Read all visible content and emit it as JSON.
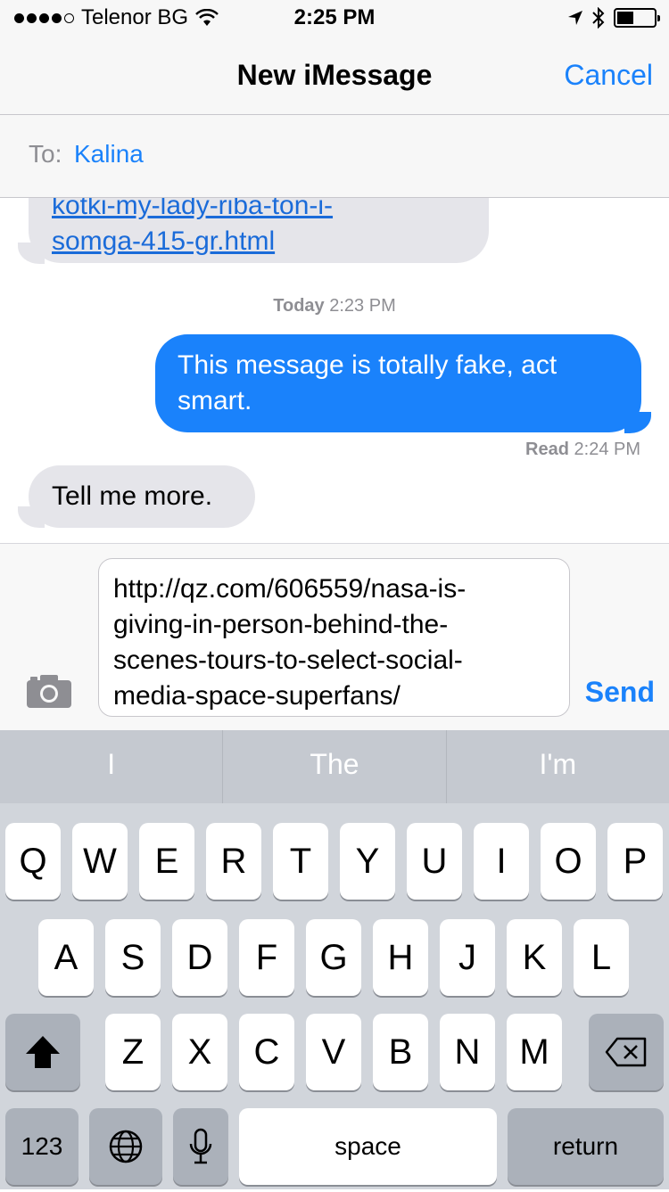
{
  "status_bar": {
    "carrier": "Telenor BG",
    "time": "2:25 PM"
  },
  "nav": {
    "title": "New iMessage",
    "cancel": "Cancel"
  },
  "to_field": {
    "label": "To:",
    "recipient": "Kalina"
  },
  "conversation": {
    "partial_link_line1": "kotki-my-lady-riba-ton-i-",
    "partial_link_line2": "somga-415-gr.html",
    "timestamp_day": "Today",
    "timestamp_time": "2:23 PM",
    "outgoing_line1": "This message is totally fake, act",
    "outgoing_line2": "smart.",
    "read_label": "Read",
    "read_time": "2:24 PM",
    "incoming": "Tell me more."
  },
  "input": {
    "line1": "http://qz.com/606559/nasa-is-",
    "line2": "giving-in-person-behind-the-",
    "line3": "scenes-tours-to-select-social-",
    "line4": "media-space-superfans/",
    "send": "Send"
  },
  "keyboard": {
    "predictions": [
      "I",
      "The",
      "I'm"
    ],
    "row1": [
      "Q",
      "W",
      "E",
      "R",
      "T",
      "Y",
      "U",
      "I",
      "O",
      "P"
    ],
    "row2": [
      "A",
      "S",
      "D",
      "F",
      "G",
      "H",
      "J",
      "K",
      "L"
    ],
    "row3": [
      "Z",
      "X",
      "C",
      "V",
      "B",
      "N",
      "M"
    ],
    "numbers": "123",
    "space": "space",
    "return": "return"
  },
  "colors": {
    "accent": "#1a82fb",
    "incoming_bubble": "#e5e5ea",
    "keyboard_bg": "#d1d5db"
  }
}
